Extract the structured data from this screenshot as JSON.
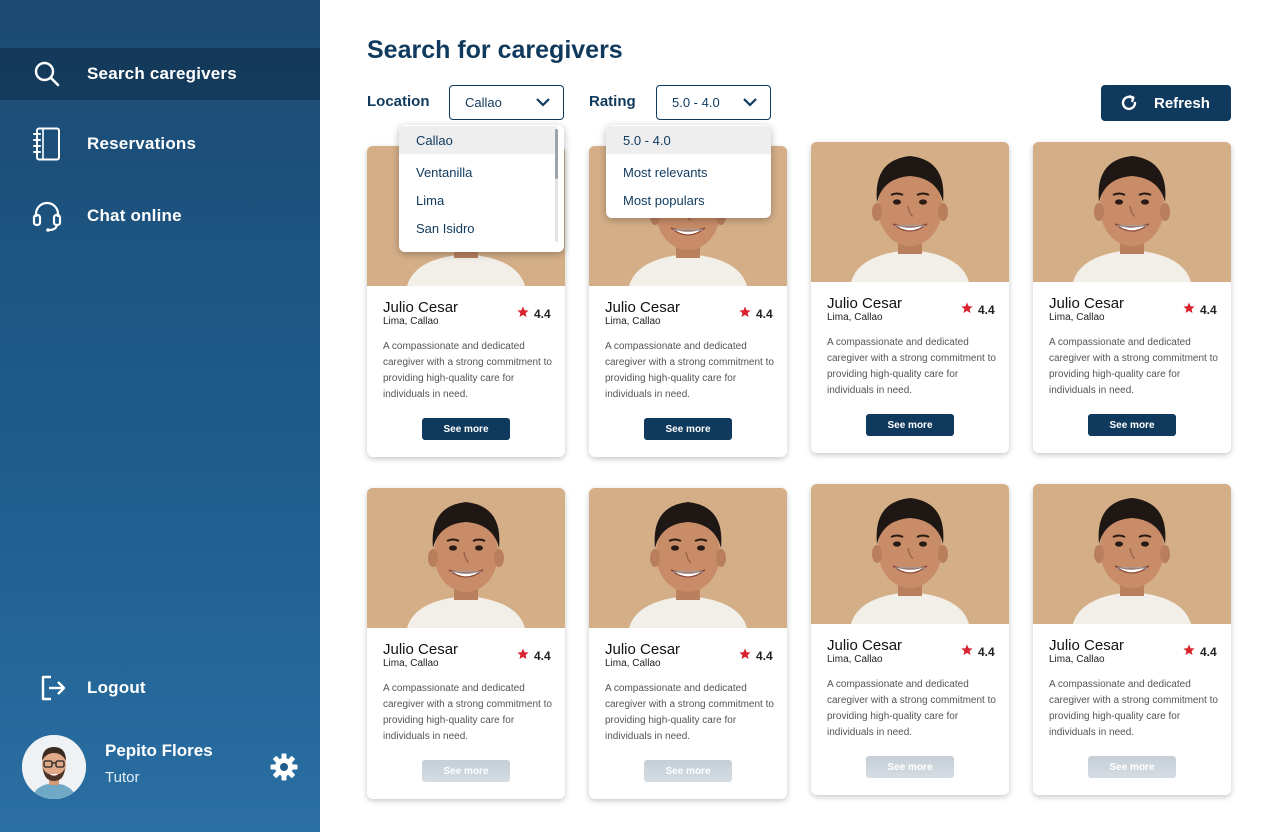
{
  "sidebar": {
    "nav": [
      {
        "label": "Search caregivers",
        "icon": "search-icon"
      },
      {
        "label": "Reservations",
        "icon": "notebook-icon"
      },
      {
        "label": "Chat online",
        "icon": "headset-icon"
      }
    ],
    "logout_label": "Logout",
    "profile": {
      "name": "Pepito Flores",
      "role": "Tutor"
    }
  },
  "page": {
    "title": "Search for caregivers"
  },
  "filters": {
    "location_label": "Location",
    "location_value": "Callao",
    "location_options": [
      "Callao",
      "Ventanilla",
      "Lima",
      "San Isidro"
    ],
    "rating_label": "Rating",
    "rating_value": "5.0 - 4.0",
    "rating_options": [
      "5.0 - 4.0",
      "Most relevants",
      "Most populars"
    ]
  },
  "refresh_label": "Refresh",
  "cards": [
    {
      "name": "Julio Cesar",
      "location": "Lima, Callao",
      "rating": "4.4",
      "description": "A compassionate and dedicated caregiver with a strong commitment to providing high-quality care for individuals in need.",
      "button": "See more"
    },
    {
      "name": "Julio Cesar",
      "location": "Lima, Callao",
      "rating": "4.4",
      "description": "A compassionate and dedicated caregiver with a strong commitment to providing high-quality care for individuals in need.",
      "button": "See more"
    },
    {
      "name": "Julio Cesar",
      "location": "Lima, Callao",
      "rating": "4.4",
      "description": "A compassionate and dedicated caregiver with a strong commitment to providing high-quality care for individuals in need.",
      "button": "See more"
    },
    {
      "name": "Julio Cesar",
      "location": "Lima, Callao",
      "rating": "4.4",
      "description": "A compassionate and dedicated caregiver with a strong commitment to providing high-quality care for individuals in need.",
      "button": "See more"
    },
    {
      "name": "Julio Cesar",
      "location": "Lima, Callao",
      "rating": "4.4",
      "description": "A compassionate and dedicated caregiver with a strong commitment to providing high-quality care for individuals in need.",
      "button": "See more"
    },
    {
      "name": "Julio Cesar",
      "location": "Lima, Callao",
      "rating": "4.4",
      "description": "A compassionate and dedicated caregiver with a strong commitment to providing high-quality care for individuals in need.",
      "button": "See more"
    },
    {
      "name": "Julio Cesar",
      "location": "Lima, Callao",
      "rating": "4.4",
      "description": "A compassionate and dedicated caregiver with a strong commitment to providing high-quality care for individuals in need.",
      "button": "See more"
    },
    {
      "name": "Julio Cesar",
      "location": "Lima, Callao",
      "rating": "4.4",
      "description": "A compassionate and dedicated caregiver with a strong commitment to providing high-quality care for individuals in need.",
      "button": "See more"
    }
  ],
  "colors": {
    "primary": "#0f3a5e",
    "star": "#d9232e",
    "photo_bg": "#d6b28a"
  }
}
